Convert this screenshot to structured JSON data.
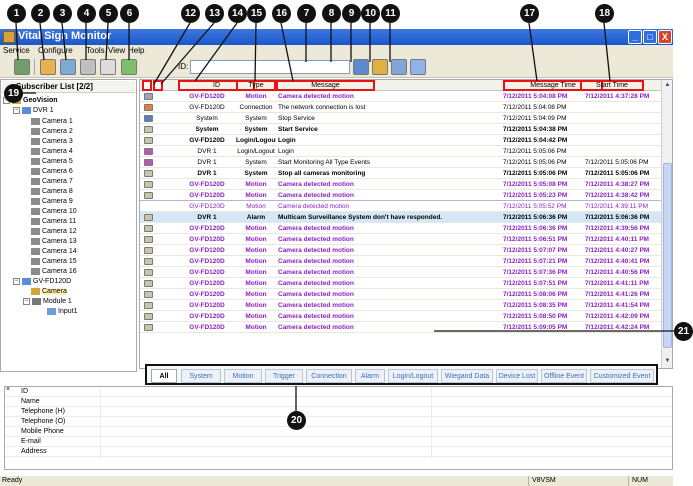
{
  "window": {
    "title": "Vital Sign Monitor",
    "controls": [
      "_",
      "□",
      "X"
    ]
  },
  "menu": [
    "Service",
    "Configure",
    "Tools",
    "View",
    "Help"
  ],
  "toolbar": {
    "id_label": "ID:",
    "id_value": ""
  },
  "callouts": [
    "1",
    "2",
    "3",
    "4",
    "5",
    "6",
    "7",
    "8",
    "9",
    "10",
    "11",
    "12",
    "13",
    "14",
    "15",
    "16",
    "17",
    "18",
    "19",
    "20",
    "21"
  ],
  "tree": {
    "header": "Subscriber List [2/2]",
    "nodes": [
      "GeoVision",
      "DVR 1",
      "Camera 1",
      "Camera 2",
      "Camera 3",
      "Camera 4",
      "Camera 5",
      "Camera 6",
      "Camera 7",
      "Camera 8",
      "Camera 9",
      "Camera 10",
      "Camera 11",
      "Camera 12",
      "Camera 13",
      "Camera 14",
      "Camera 15",
      "Camera 16",
      "GV-FD120D",
      "Camera",
      "Module 1",
      "Input1"
    ]
  },
  "table": {
    "columns": [
      "ID",
      "Type",
      "Message",
      "Message Time",
      "Start Time"
    ],
    "rows": [
      {
        "icon": "#9aa7b5",
        "id": "GV-FD120D",
        "type": "Motion",
        "message": "Camera detected motion",
        "msg_time": "7/12/2011 5:04:08 PM",
        "start": "7/12/2011 4:37:28 PM",
        "style": "motion bold"
      },
      {
        "icon": "#e87f3a",
        "id": "GV-FD120D",
        "type": "Connection",
        "message": "The network connection is lost",
        "msg_time": "7/12/2011 5:04:08 PM",
        "start": "",
        "style": ""
      },
      {
        "icon": "#5a7fc1",
        "id": "System",
        "type": "System",
        "message": "Stop Service",
        "msg_time": "7/12/2011 5:04:09 PM",
        "start": "",
        "style": ""
      },
      {
        "icon": "#c9c5a8",
        "id": "System",
        "type": "System",
        "message": "Start Service",
        "msg_time": "7/12/2011 5:04:38 PM",
        "start": "",
        "style": "bold"
      },
      {
        "icon": "#c9c5a8",
        "id": "GV-FD120D",
        "type": "Login/Logout",
        "message": "Login",
        "msg_time": "7/12/2011 5:04:42 PM",
        "start": "",
        "style": "bold"
      },
      {
        "icon": "#b85ab0",
        "id": "DVR 1",
        "type": "Login/Logout",
        "message": "Login",
        "msg_time": "7/12/2011 5:05:06 PM",
        "start": "",
        "style": ""
      },
      {
        "icon": "#b85ab0",
        "id": "DVR 1",
        "type": "System",
        "message": "Start Monitoring All Type Events",
        "msg_time": "7/12/2011 5:05:06 PM",
        "start": "7/12/2011 5:05:06 PM",
        "style": ""
      },
      {
        "icon": "#c9c5a8",
        "id": "DVR 1",
        "type": "System",
        "message": "Stop all cameras monitoring",
        "msg_time": "7/12/2011 5:05:06 PM",
        "start": "7/12/2011 5:05:06 PM",
        "style": "bold"
      },
      {
        "icon": "#c9c5a8",
        "id": "GV-FD120D",
        "type": "Motion",
        "message": "Camera detected motion",
        "msg_time": "7/12/2011 5:05:08 PM",
        "start": "7/12/2011 4:38:27 PM",
        "style": "motion bold"
      },
      {
        "icon": "#c9c5a8",
        "id": "GV-FD120D",
        "type": "Motion",
        "message": "Camera detected motion",
        "msg_time": "7/12/2011 5:05:23 PM",
        "start": "7/12/2011 4:38:42 PM",
        "style": "motion bold"
      },
      {
        "icon": "",
        "id": "GV-FD120D",
        "type": "Motion",
        "message": "Camera detected motion",
        "msg_time": "7/12/2011 5:05:52 PM",
        "start": "7/12/2011 4:39:11 PM",
        "style": "sel"
      },
      {
        "icon": "#c9c5a8",
        "id": "DVR 1",
        "type": "Alarm",
        "message": "Multicam Surveillance System don't have responded.",
        "msg_time": "7/12/2011 5:06:36 PM",
        "start": "7/12/2011 5:06:36 PM",
        "style": "bold hl"
      },
      {
        "icon": "#c9c5a8",
        "id": "GV-FD120D",
        "type": "Motion",
        "message": "Camera detected motion",
        "msg_time": "7/12/2011 5:06:36 PM",
        "start": "7/12/2011 4:39:56 PM",
        "style": "motion bold"
      },
      {
        "icon": "#c9c5a8",
        "id": "GV-FD120D",
        "type": "Motion",
        "message": "Camera detected motion",
        "msg_time": "7/12/2011 5:06:51 PM",
        "start": "7/12/2011 4:40:11 PM",
        "style": "motion bold"
      },
      {
        "icon": "#c9c5a8",
        "id": "GV-FD120D",
        "type": "Motion",
        "message": "Camera detected motion",
        "msg_time": "7/12/2011 5:07:07 PM",
        "start": "7/12/2011 4:40:27 PM",
        "style": "motion bold"
      },
      {
        "icon": "#c9c5a8",
        "id": "GV-FD120D",
        "type": "Motion",
        "message": "Camera detected motion",
        "msg_time": "7/12/2011 5:07:21 PM",
        "start": "7/12/2011 4:40:41 PM",
        "style": "motion bold"
      },
      {
        "icon": "#c9c5a8",
        "id": "GV-FD120D",
        "type": "Motion",
        "message": "Camera detected motion",
        "msg_time": "7/12/2011 5:07:36 PM",
        "start": "7/12/2011 4:40:56 PM",
        "style": "motion bold"
      },
      {
        "icon": "#c9c5a8",
        "id": "GV-FD120D",
        "type": "Motion",
        "message": "Camera detected motion",
        "msg_time": "7/12/2011 5:07:51 PM",
        "start": "7/12/2011 4:41:11 PM",
        "style": "motion bold"
      },
      {
        "icon": "#c9c5a8",
        "id": "GV-FD120D",
        "type": "Motion",
        "message": "Camera detected motion",
        "msg_time": "7/12/2011 5:08:06 PM",
        "start": "7/12/2011 4:41:26 PM",
        "style": "motion bold"
      },
      {
        "icon": "#c9c5a8",
        "id": "GV-FD120D",
        "type": "Motion",
        "message": "Camera detected motion",
        "msg_time": "7/12/2011 5:08:35 PM",
        "start": "7/12/2011 4:41:54 PM",
        "style": "motion bold"
      },
      {
        "icon": "#c9c5a8",
        "id": "GV-FD120D",
        "type": "Motion",
        "message": "Camera detected motion",
        "msg_time": "7/12/2011 5:08:50 PM",
        "start": "7/12/2011 4:42:09 PM",
        "style": "motion bold"
      },
      {
        "icon": "#c9c5a8",
        "id": "GV-FD120D",
        "type": "Motion",
        "message": "Camera detected motion",
        "msg_time": "7/12/2011 5:09:05 PM",
        "start": "7/12/2011 4:42:24 PM",
        "style": "motion bold"
      }
    ]
  },
  "tabs": [
    "All",
    "System",
    "Motion",
    "Trigger",
    "Connection",
    "Alarm",
    "Login/Logout",
    "Wiegand Data",
    "Device Lost",
    "Offline Event",
    "Customized Event"
  ],
  "details": {
    "close_glyph": "×",
    "fields": [
      "ID",
      "Name",
      "Telephone (H)",
      "Telephone (O)",
      "Mobile Phone",
      "E-mail",
      "Address"
    ]
  },
  "status": {
    "left": "Ready",
    "mid": "V8VSM",
    "right": "NUM"
  },
  "colors": {
    "titlebar": "#1b57c9",
    "motion_text": "#8b1fc4",
    "highlight_row": "#d4e7f6",
    "callout_box": "#e11111"
  }
}
